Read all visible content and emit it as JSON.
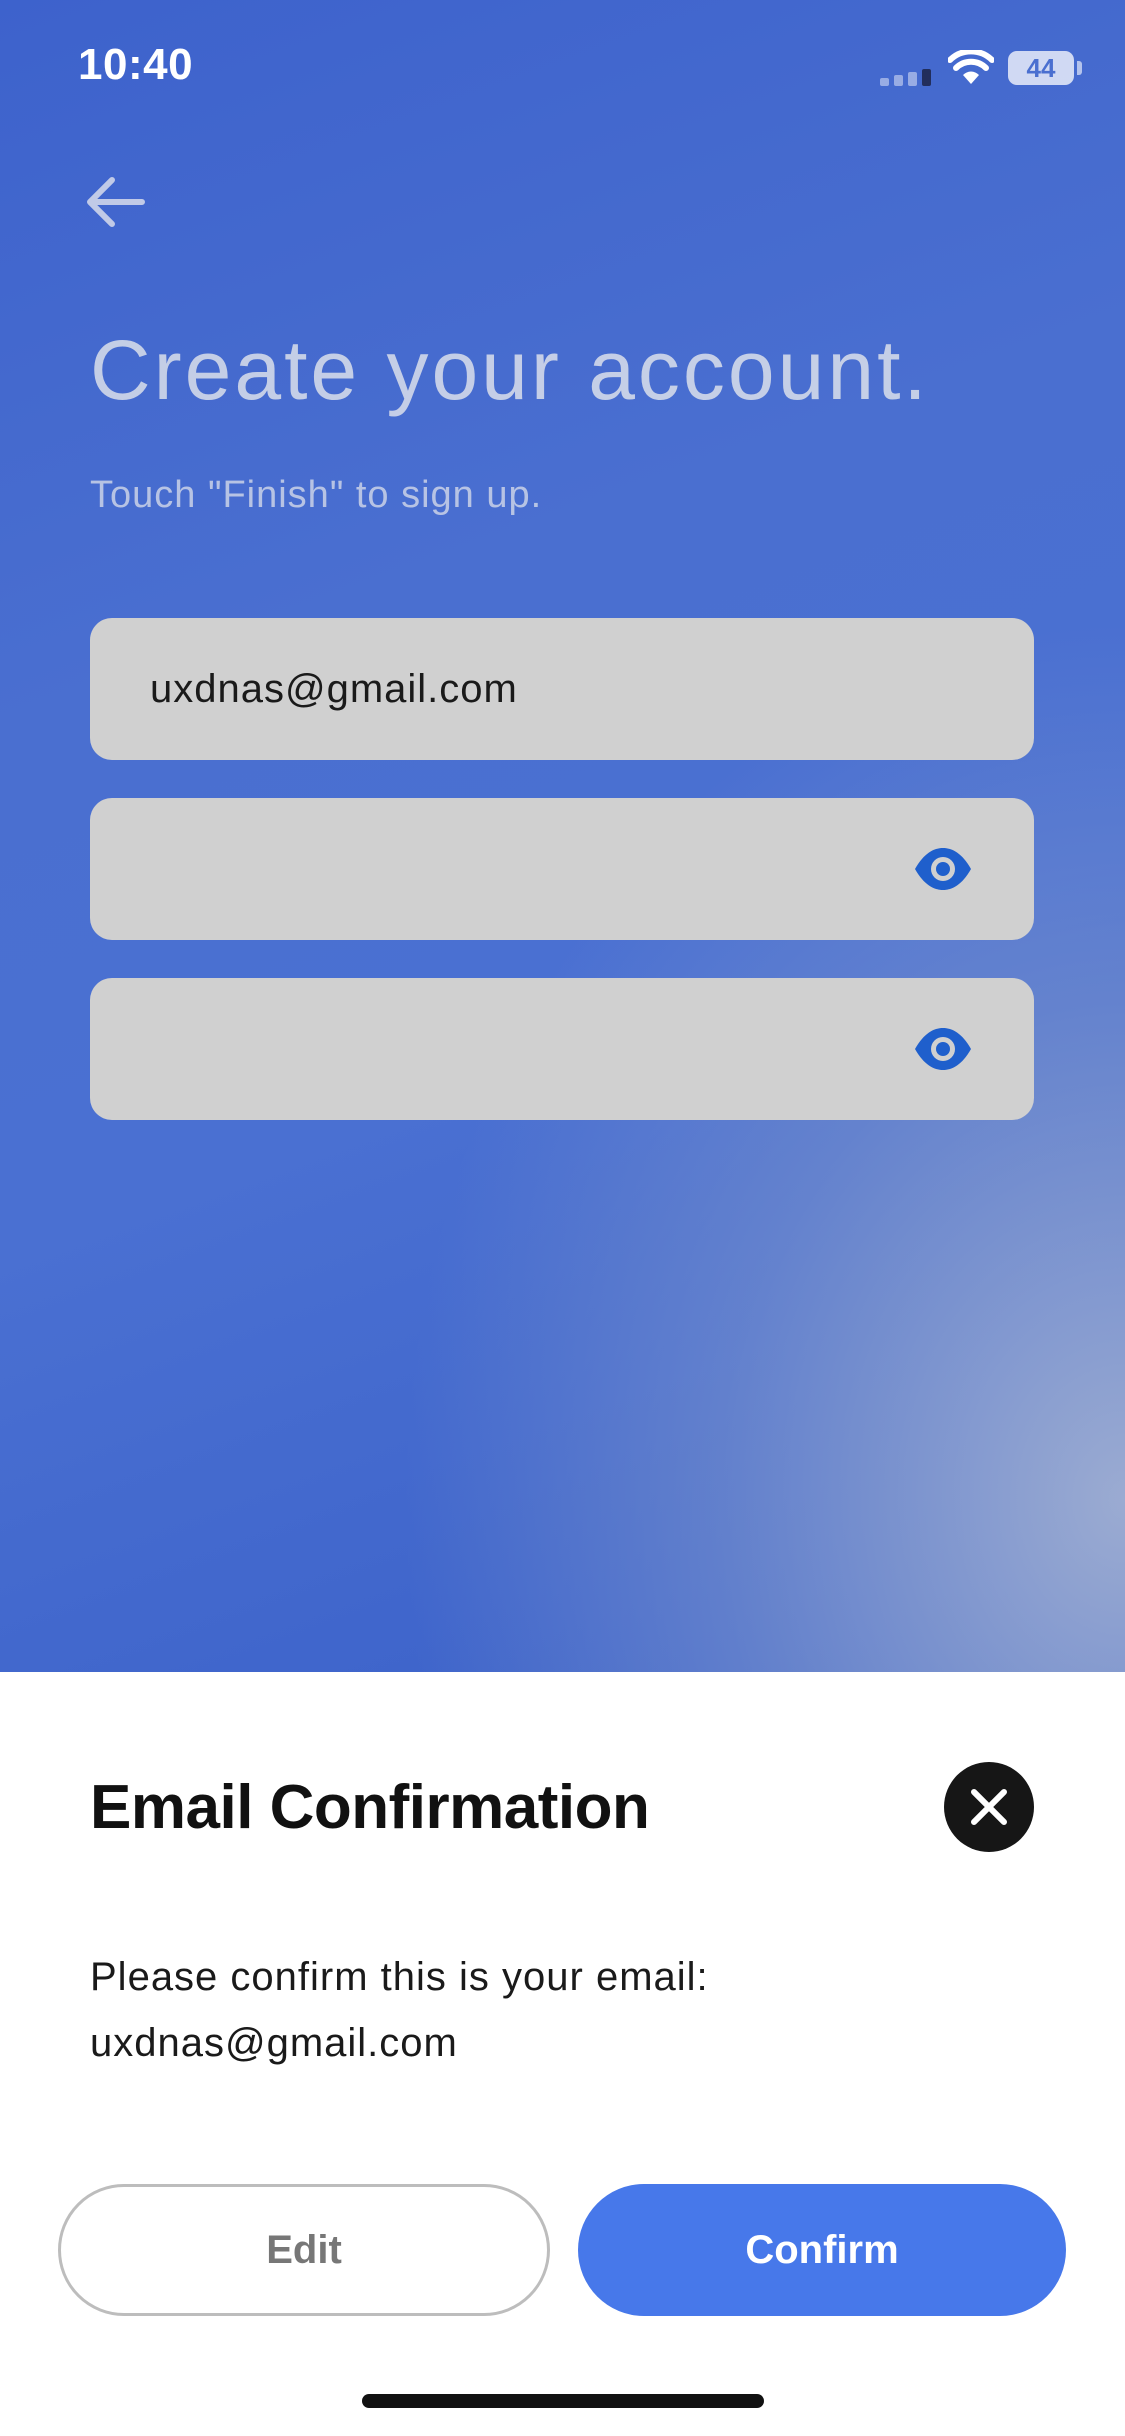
{
  "status_bar": {
    "time": "10:40",
    "battery": "44",
    "icons": [
      "cellular-signal-icon",
      "wifi-icon",
      "battery-icon"
    ]
  },
  "header": {
    "back_icon": "arrow-left-icon",
    "title": "Create your account.",
    "subtitle": "Touch \"Finish\" to sign up."
  },
  "form": {
    "email_value": "uxdnas@gmail.com",
    "password_value": "",
    "confirm_password_value": "",
    "visibility_icon": "eye-icon"
  },
  "sheet": {
    "title": "Email Confirmation",
    "close_icon": "close-icon",
    "message_line1": "Please confirm this is your email:",
    "message_line2": "uxdnas@gmail.com",
    "edit_label": "Edit",
    "confirm_label": "Confirm"
  },
  "colors": {
    "background_blue": "#4a6fd0",
    "field_gray": "#d0d0d0",
    "eye_blue": "#1f5fcc",
    "confirm_blue": "#4778ea",
    "close_black": "#161616"
  }
}
